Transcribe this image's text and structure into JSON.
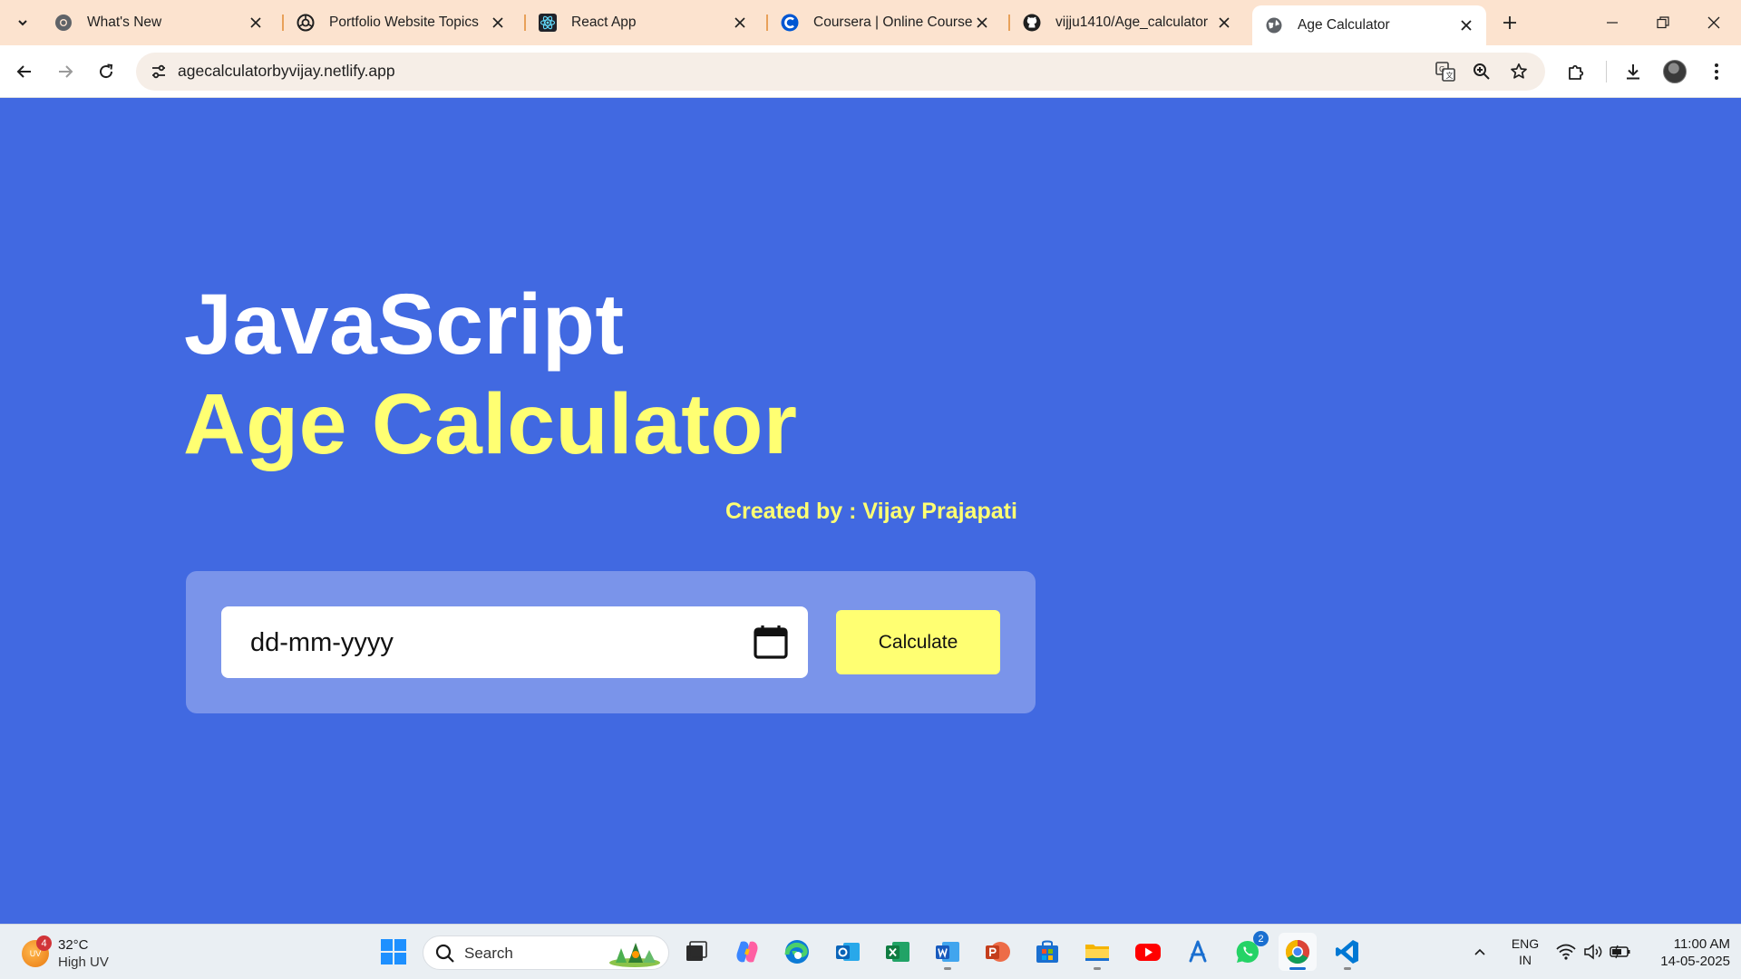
{
  "browser": {
    "tabs": [
      {
        "title": "What's New",
        "icon": "chrome-icon"
      },
      {
        "title": "Portfolio Website Topics",
        "icon": "openai-icon"
      },
      {
        "title": "React App",
        "icon": "react-icon"
      },
      {
        "title": "Coursera | Online Courses",
        "icon": "coursera-icon"
      },
      {
        "title": "vijju1410/Age_calculator",
        "icon": "github-icon"
      },
      {
        "title": "Age Calculator",
        "icon": "globe-icon",
        "active": true
      }
    ],
    "url": "agecalculatorbyvijay.netlify.app"
  },
  "page": {
    "heading_line1": "JavaScript",
    "heading_line2": "Age Calculator",
    "created_by": "Created by : Vijay Prajapati",
    "date_placeholder": "dd-mm-yyyy",
    "calculate_label": "Calculate"
  },
  "taskbar": {
    "weather_temp": "32°C",
    "weather_desc": "High UV",
    "weather_badge": "4",
    "search_label": "Search",
    "whatsapp_badge": "2",
    "language_line1": "ENG",
    "language_line2": "IN",
    "time": "11:00 AM",
    "date": "14-05-2025"
  },
  "colors": {
    "page_background": "#4169e1",
    "heading_white": "#ffffff",
    "heading_yellow": "#ffff72",
    "card_background": "#7a94ea",
    "tabstrip_background": "#fce3cf"
  }
}
